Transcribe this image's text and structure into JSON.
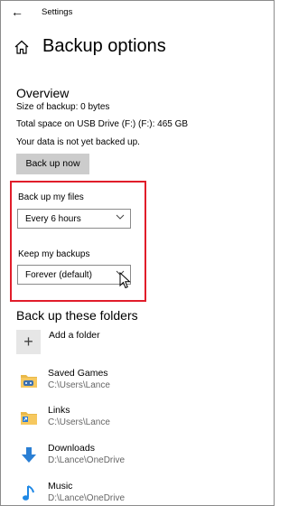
{
  "window": {
    "title": "Settings"
  },
  "header": {
    "title": "Backup options"
  },
  "overview": {
    "heading": "Overview",
    "size_of_backup": "Size of backup: 0 bytes",
    "total_space": "Total space on USB Drive (F:) (F:): 465 GB",
    "status": "Your data is not yet backed up.",
    "back_up_now_label": "Back up now"
  },
  "backup_frequency": {
    "label": "Back up my files",
    "selected": "Every 6 hours"
  },
  "keep_backups": {
    "label": "Keep my backups",
    "selected": "Forever (default)"
  },
  "folders_section": {
    "heading": "Back up these folders",
    "add_label": "Add a folder",
    "items": [
      {
        "name": "Saved Games",
        "path": "C:\\Users\\Lance",
        "icon": "saved-games-folder-icon"
      },
      {
        "name": "Links",
        "path": "C:\\Users\\Lance",
        "icon": "links-folder-icon"
      },
      {
        "name": "Downloads",
        "path": "D:\\Lance\\OneDrive",
        "icon": "downloads-icon"
      },
      {
        "name": "Music",
        "path": "D:\\Lance\\OneDrive",
        "icon": "music-icon"
      }
    ]
  },
  "colors": {
    "highlight": "#e11d2a",
    "button_bg": "#cccccc",
    "accent": "#0078d7"
  }
}
